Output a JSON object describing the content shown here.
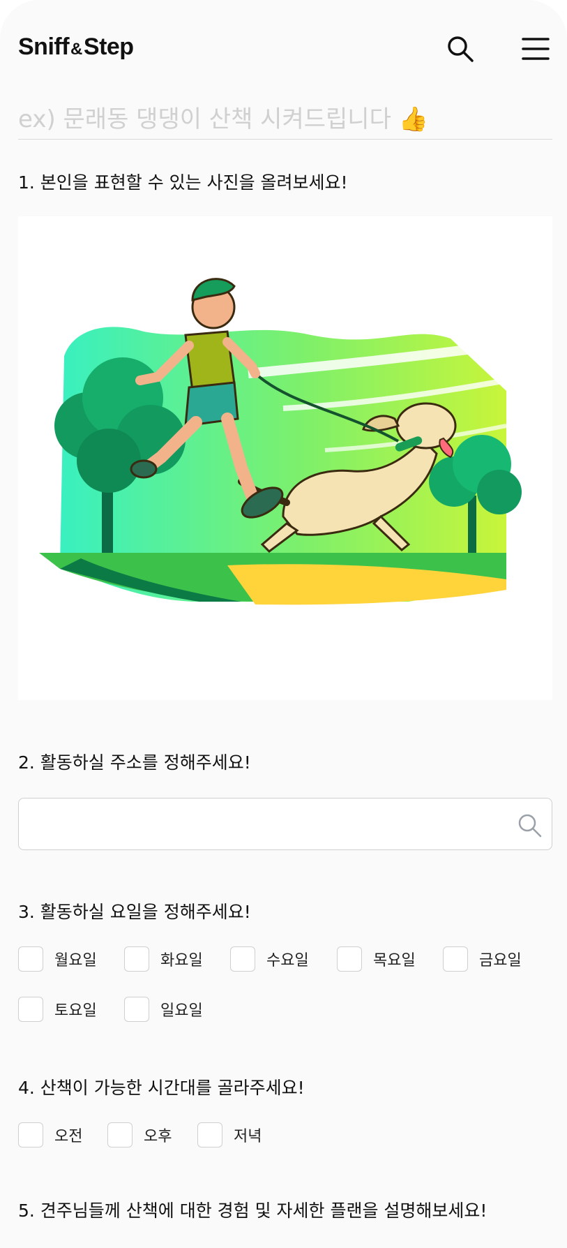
{
  "header": {
    "logo_left": "Sniff",
    "logo_amp": "&",
    "logo_right": "Step",
    "search_icon": "search-icon",
    "menu_icon": "hamburger-menu-icon"
  },
  "post": {
    "title_placeholder": "ex) 문래동 댕댕이 산책 시켜드립니다 👍"
  },
  "questions": {
    "q1": "1. 본인을 표현할 수 있는 사진을 올려보세요!",
    "q2": "2. 활동하실 주소를 정해주세요!",
    "q3": "3. 활동하실 요일을 정해주세요!",
    "q4": "4. 산책이 가능한 시간대를 골라주세요!",
    "q5": "5. 견주님들께 산책에 대한 경험 및 자세한 플랜을 설명해보세요!"
  },
  "address": {
    "value": "",
    "icon": "search-icon"
  },
  "days": [
    "월요일",
    "화요일",
    "수요일",
    "목요일",
    "금요일",
    "토요일",
    "일요일"
  ],
  "times": [
    "오전",
    "오후",
    "저녁"
  ],
  "colors": {
    "background": "#fafafa",
    "border": "#cfcfcf",
    "placeholder": "#d0d0d0",
    "accent_green": "#2ecc71"
  }
}
